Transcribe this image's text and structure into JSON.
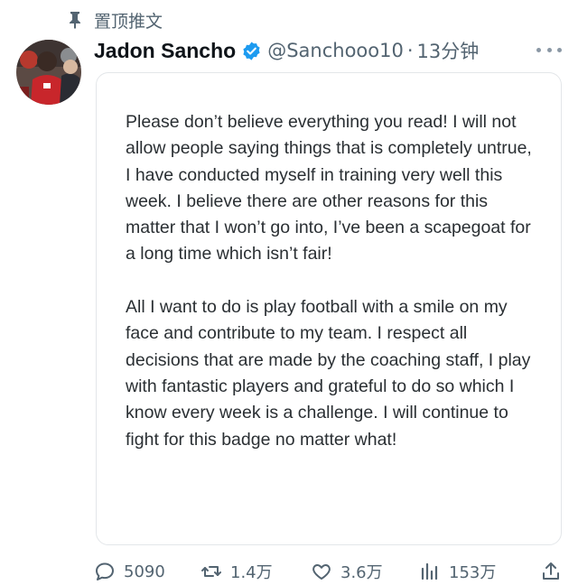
{
  "pinned": {
    "label": "置顶推文",
    "icon": "pin-icon"
  },
  "tweet": {
    "author": {
      "display_name": "Jadon Sancho",
      "handle": "@Sanchooo10",
      "verified": true,
      "avatar_icon": "avatar-photo"
    },
    "separator": "·",
    "time": "13分钟",
    "paragraphs": [
      "Please don’t believe everything you read! I will not allow people saying things that is completely untrue, I have conducted myself in training very well this week. I believe there are other reasons for this matter that I won’t go into, I’ve been a scapegoat for a long time which isn’t fair!",
      "All I want to do is play football with a smile on my face and contribute to my team. I respect all decisions that are made by the coaching staff, I play with fantastic players and grateful to do so which I know every week is a challenge. I will continue to fight for this badge no matter what!"
    ]
  },
  "actions": {
    "replies": "5090",
    "retweets": "1.4万",
    "likes": "3.6万",
    "views": "153万"
  },
  "colors": {
    "text": "#0f1419",
    "secondary": "#536471",
    "verified": "#1d9bf0",
    "card_border": "#e3e6e9"
  }
}
